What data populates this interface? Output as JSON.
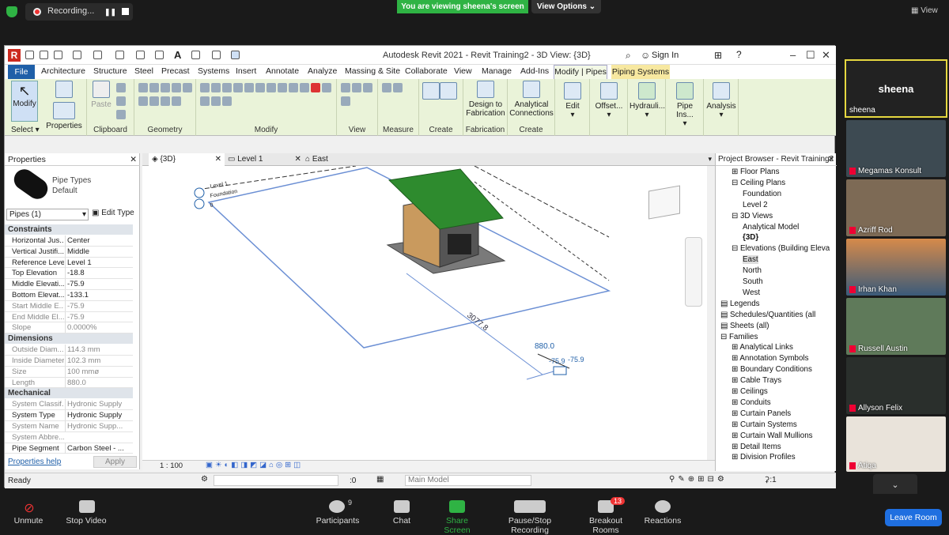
{
  "zoom_top": {
    "recording_label": "Recording...",
    "viewing_banner": "You are viewing sheena's screen",
    "view_options": "View Options",
    "view_label": "View"
  },
  "revit": {
    "title": "Autodesk Revit 2021 - Revit Training2 - 3D View: {3D}",
    "sign_in": "Sign In",
    "tabs": [
      "File",
      "Architecture",
      "Structure",
      "Steel",
      "Precast",
      "Systems",
      "Insert",
      "Annotate",
      "Analyze",
      "Massing & Site",
      "Collaborate",
      "View",
      "Manage",
      "Add-Ins",
      "Modify | Pipes",
      "Piping Systems"
    ],
    "ribbon": {
      "select_group": "Select",
      "modify": "Modify",
      "properties": "Properties",
      "paste": "Paste",
      "clipboard": "Clipboard",
      "geometry": "Geometry",
      "modify_group": "Modify",
      "view_group": "View",
      "measure_group": "Measure",
      "create_group": "Create",
      "design_fab": "Design to Fabrication",
      "fabrication_group": "Fabrication",
      "analytical_conn": "Analytical Connections",
      "create_group2": "Create",
      "edit": "Edit",
      "offset": "Offset...",
      "hydrauli": "Hydrauli...",
      "pipe_ins": "Pipe Ins...",
      "analysis": "Analysis"
    },
    "properties": {
      "title": "Properties",
      "type_line1": "Pipe Types",
      "type_line2": "Default",
      "selector": "Pipes (1)",
      "edit_type": "Edit Type",
      "sections": [
        {
          "name": "Constraints",
          "rows": [
            {
              "k": "Horizontal Jus...",
              "v": "Center",
              "dim": false
            },
            {
              "k": "Vertical Justifi...",
              "v": "Middle",
              "dim": false
            },
            {
              "k": "Reference Level",
              "v": "Level 1",
              "dim": false
            },
            {
              "k": "Top Elevation",
              "v": "-18.8",
              "dim": false
            },
            {
              "k": "Middle Elevati...",
              "v": "-75.9",
              "dim": false
            },
            {
              "k": "Bottom Elevat...",
              "v": "-133.1",
              "dim": false
            },
            {
              "k": "Start Middle E...",
              "v": "-75.9",
              "dim": true
            },
            {
              "k": "End Middle El...",
              "v": "-75.9",
              "dim": true
            },
            {
              "k": "Slope",
              "v": "0.0000%",
              "dim": true
            }
          ]
        },
        {
          "name": "Dimensions",
          "rows": [
            {
              "k": "Outside Diam...",
              "v": "114.3 mm",
              "dim": true
            },
            {
              "k": "Inside Diameter",
              "v": "102.3 mm",
              "dim": true
            },
            {
              "k": "Size",
              "v": "100 mmø",
              "dim": true
            },
            {
              "k": "Length",
              "v": "880.0",
              "dim": true
            }
          ]
        },
        {
          "name": "Mechanical",
          "rows": [
            {
              "k": "System Classif...",
              "v": "Hydronic Supply",
              "dim": true
            },
            {
              "k": "System Type",
              "v": "Hydronic Supply",
              "dim": false
            },
            {
              "k": "System Name",
              "v": "Hydronic Supp...",
              "dim": true
            },
            {
              "k": "System Abbre...",
              "v": "",
              "dim": true
            },
            {
              "k": "Pipe Segment",
              "v": "Carbon Steel - ...",
              "dim": false
            }
          ]
        }
      ],
      "help": "Properties help",
      "apply": "Apply"
    },
    "view_tabs": [
      "{3D}",
      "Level 1",
      "East"
    ],
    "canvas_labels": {
      "level1": "Level 1",
      "foundation": "Foundation",
      "elev": "0",
      "dim1": "3077.8",
      "dim2": "880.0",
      "dim3": "-75.9",
      "dim4": "-75.9"
    },
    "scale": "1 : 100",
    "browser": {
      "title": "Project Browser - Revit Training2",
      "items": [
        {
          "t": "Floor Plans",
          "lvl": 1,
          "exp": "+"
        },
        {
          "t": "Ceiling Plans",
          "lvl": 1,
          "exp": "-"
        },
        {
          "t": "Foundation",
          "lvl": 2,
          "exp": ""
        },
        {
          "t": "Level 2",
          "lvl": 2,
          "exp": ""
        },
        {
          "t": "3D Views",
          "lvl": 1,
          "exp": "-"
        },
        {
          "t": "Analytical Model",
          "lvl": 2,
          "exp": ""
        },
        {
          "t": "{3D}",
          "lvl": 2,
          "exp": "",
          "bold": true
        },
        {
          "t": "Elevations (Building Eleva",
          "lvl": 1,
          "exp": "-"
        },
        {
          "t": "East",
          "lvl": 2,
          "exp": "",
          "sel": true
        },
        {
          "t": "North",
          "lvl": 2,
          "exp": ""
        },
        {
          "t": "South",
          "lvl": 2,
          "exp": ""
        },
        {
          "t": "West",
          "lvl": 2,
          "exp": ""
        },
        {
          "t": "Legends",
          "lvl": 0,
          "exp": ""
        },
        {
          "t": "Schedules/Quantities (all",
          "lvl": 0,
          "exp": ""
        },
        {
          "t": "Sheets (all)",
          "lvl": 0,
          "exp": ""
        },
        {
          "t": "Families",
          "lvl": 0,
          "exp": "-"
        },
        {
          "t": "Analytical Links",
          "lvl": 1,
          "exp": "+"
        },
        {
          "t": "Annotation Symbols",
          "lvl": 1,
          "exp": "+"
        },
        {
          "t": "Boundary Conditions",
          "lvl": 1,
          "exp": "+"
        },
        {
          "t": "Cable Trays",
          "lvl": 1,
          "exp": "+"
        },
        {
          "t": "Ceilings",
          "lvl": 1,
          "exp": "+"
        },
        {
          "t": "Conduits",
          "lvl": 1,
          "exp": "+"
        },
        {
          "t": "Curtain Panels",
          "lvl": 1,
          "exp": "+"
        },
        {
          "t": "Curtain Systems",
          "lvl": 1,
          "exp": "+"
        },
        {
          "t": "Curtain Wall Mullions",
          "lvl": 1,
          "exp": "+"
        },
        {
          "t": "Detail Items",
          "lvl": 1,
          "exp": "+"
        },
        {
          "t": "Division Profiles",
          "lvl": 1,
          "exp": "+"
        }
      ]
    },
    "status": {
      "ready": "Ready",
      "zero": ":0",
      "main_model": "Main Model",
      "filter": ":1"
    }
  },
  "participants": [
    {
      "name": "sheena",
      "big": "sheena"
    },
    {
      "name": "Megamas Konsult"
    },
    {
      "name": "Azriff Rod"
    },
    {
      "name": "Irhan Khan"
    },
    {
      "name": "Russell Austin"
    },
    {
      "name": "Allyson Felix"
    },
    {
      "name": "Atiqa"
    }
  ],
  "zoom_bottom": {
    "unmute": "Unmute",
    "stop_video": "Stop Video",
    "participants": "Participants",
    "participants_count": "9",
    "chat": "Chat",
    "share_screen": "Share Screen",
    "pause_stop": "Pause/Stop Recording",
    "breakout": "Breakout Rooms",
    "breakout_badge": "13",
    "reactions": "Reactions",
    "leave": "Leave Room"
  },
  "colors": {
    "zoom_green": "#2fb344",
    "revit_ribbon": "#eaf3d9",
    "leave_blue": "#1f6fe0",
    "active_speaker": "#e6d840"
  }
}
